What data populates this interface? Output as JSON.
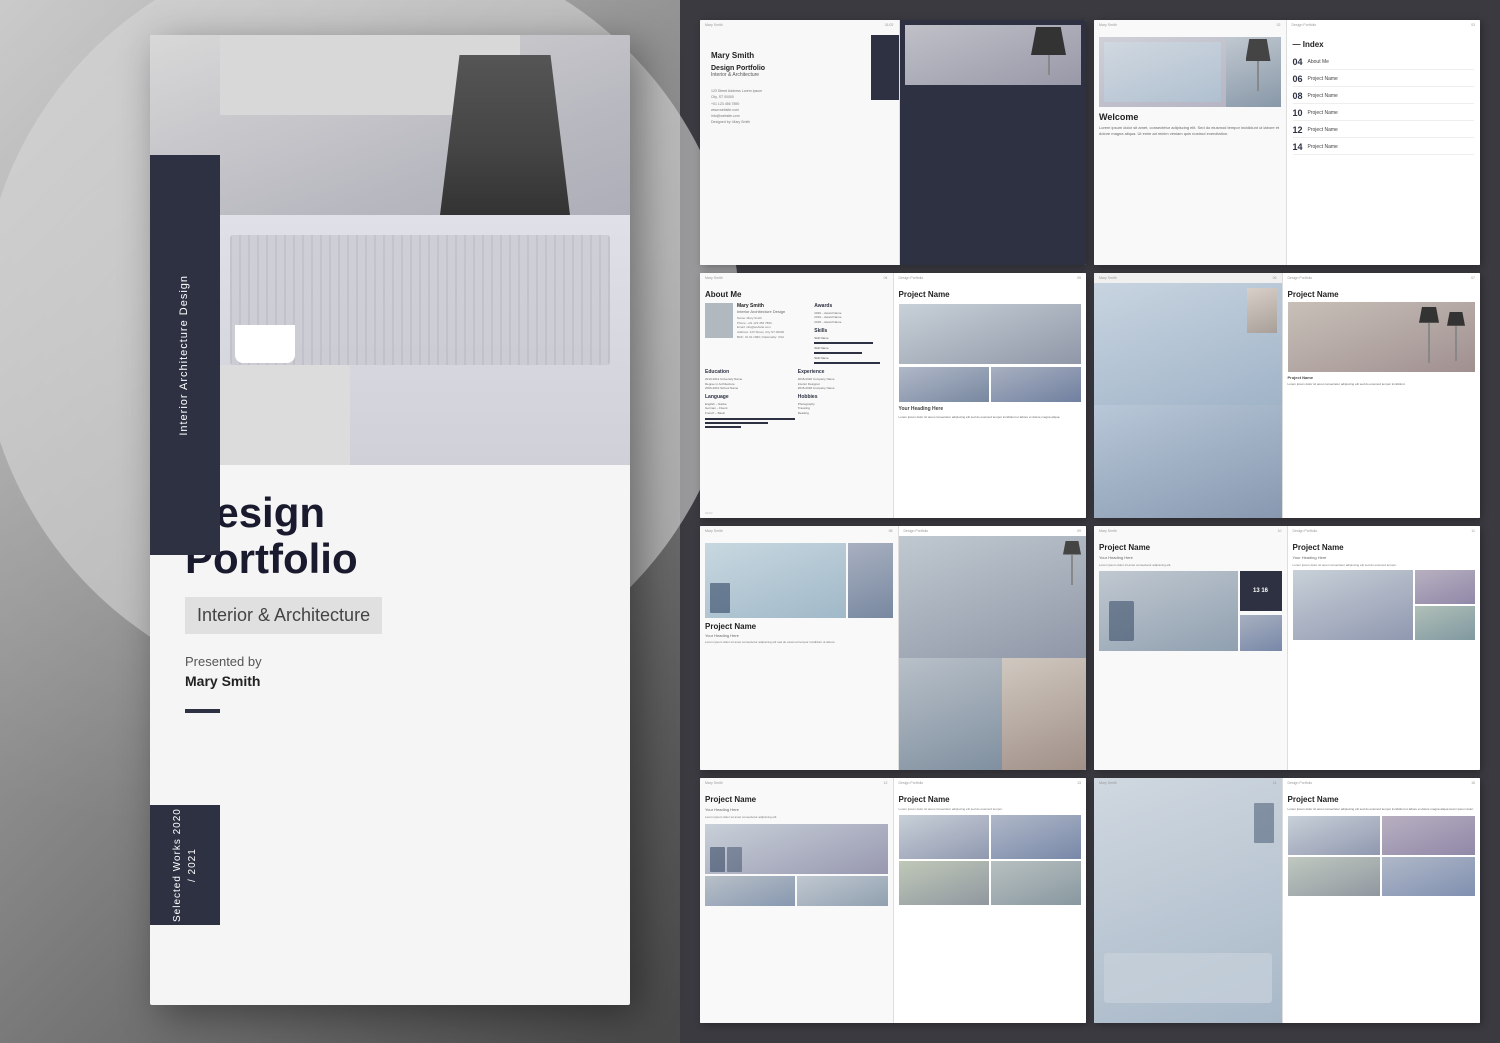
{
  "background": {
    "left_color": "#c0c0c0",
    "right_color": "#3a3a40"
  },
  "cover": {
    "vertical_text1": "Interior Architecture Design",
    "vertical_text2": "Selected Works 2020 / 2021",
    "title_line1": "Design",
    "title_line2": "Portfolio",
    "subtitle": "Interior & Architecture",
    "presented_by": "Presented by",
    "author": "Mary Smith"
  },
  "spread1": {
    "left_name": "Mary Smith",
    "left_portfolio": "Design Portfolio",
    "left_interior": "Interior & Architecture",
    "left_info": "123 Street Address Lorem Ipsum\nCity, ST 00000\nPhone: +01 123 456 7890\nwww.website.com\ninfo@website.com\nDesigned by: Mary Smith"
  },
  "spread2": {
    "left_welcome": "Welcome",
    "left_body": "Lorem ipsum dolor sit amet, consectetur adipiscing elit. Sed do eiusmod tempor incididunt ut labore et dolore magna aliqua. Ut enim ad minim veniam quis nostrud exercitation.",
    "right_title": "— Index",
    "index_items": [
      {
        "num": "04",
        "label": "About Me"
      },
      {
        "num": "06",
        "label": "Project Name"
      },
      {
        "num": "08",
        "label": "Project Name"
      },
      {
        "num": "10",
        "label": "Project Name"
      },
      {
        "num": "12",
        "label": "Project Name"
      },
      {
        "num": "14",
        "label": "Project Name"
      }
    ]
  },
  "spread3": {
    "title": "About Me",
    "name": "Mary Smith",
    "role": "Interior Architecture Design",
    "sections": {
      "awards": "Awards",
      "skills": "Skills",
      "education": "Education",
      "experience": "Experience",
      "language": "Language",
      "hobbies": "Hobbies"
    }
  },
  "spread4": {
    "title": "Project Name",
    "heading": "Your Heading Here",
    "body_text": "Lorem ipsum dolor sit amet consectetur adipiscing elit sed do eiusmod tempor incididunt ut labore et dolore magna aliqua."
  },
  "spread5": {
    "left_title": "Project Name",
    "left_subtitle": "Your Heading Here",
    "right_title": "Project Name",
    "right_text": "Lorem ipsum dolor sit amet consectetur adipiscing elit sed do eiusmod tempor incididunt."
  },
  "spread6": {
    "left_title": "Project Name",
    "left_subtitle": "Your Heading Here",
    "left_text": "Lorem ipsum dolor sit amet consectetur adipiscing elit.",
    "clock_display": "13 16",
    "right_title": "Project Name",
    "right_subtitle": "Your Heading Here",
    "right_text": "Lorem ipsum dolor sit amet consectetur adipiscing elit sed do eiusmod tempor."
  },
  "spread7": {
    "left_title": "Project Name",
    "left_subtitle": "Your Heading Here",
    "left_text": "Lorem ipsum dolor sit amet consectetur adipiscing elit.",
    "right_title": "Project Name",
    "right_text": "Lorem ipsum dolor sit amet consectetur adipiscing elit sed do eiusmod tempor."
  },
  "page_numbers": {
    "spread3_left": "01/02",
    "spread3_right": "03/04",
    "spread4_left": "04",
    "spread4_right": "05",
    "spread5_left": "06",
    "spread5_right": "07",
    "spread6_left": "08",
    "spread6_right": "09",
    "spread7_left": "10",
    "spread7_right": "11"
  }
}
